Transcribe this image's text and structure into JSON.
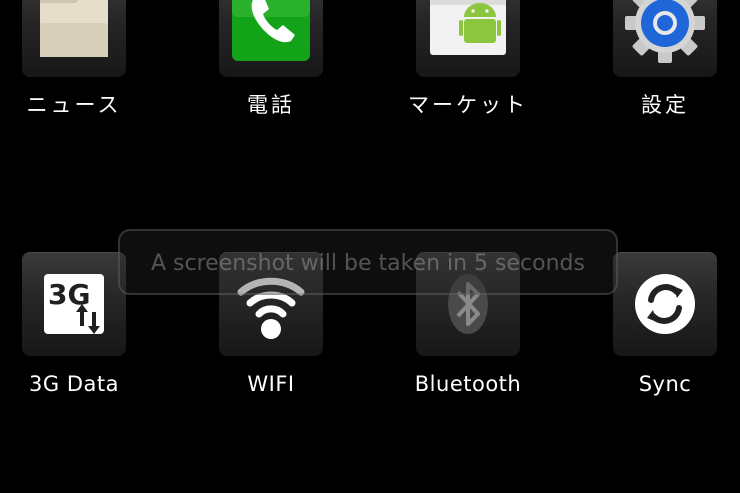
{
  "apps_row1": [
    {
      "label": "ニュース",
      "icon": "news-folder-icon"
    },
    {
      "label": "電話",
      "icon": "phone-icon"
    },
    {
      "label": "マーケット",
      "icon": "market-icon"
    },
    {
      "label": "設定",
      "icon": "gear-icon"
    }
  ],
  "apps_row2": [
    {
      "label": "3G Data",
      "icon": "3g-data-icon",
      "icon_text": "3G"
    },
    {
      "label": "WIFI",
      "icon": "wifi-icon"
    },
    {
      "label": "Bluetooth",
      "icon": "bluetooth-icon"
    },
    {
      "label": "Sync",
      "icon": "sync-icon"
    }
  ],
  "toast": {
    "message": "A screenshot will be taken in 5 seconds"
  },
  "colors": {
    "background": "#000000",
    "phone_green": "#16a31a",
    "gear_blue": "#1f66d8",
    "android_green": "#8cc63f"
  }
}
